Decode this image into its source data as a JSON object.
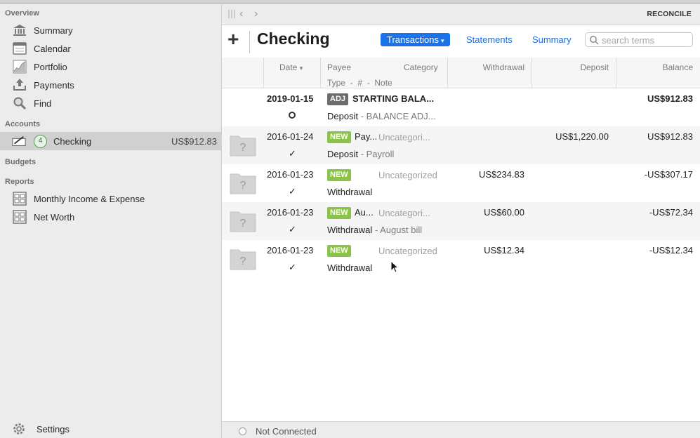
{
  "sidebar": {
    "overview_label": "Overview",
    "overview_items": [
      {
        "label": "Summary",
        "icon": "bank-icon"
      },
      {
        "label": "Calendar",
        "icon": "calendar-icon"
      },
      {
        "label": "Portfolio",
        "icon": "chart-icon"
      },
      {
        "label": "Payments",
        "icon": "upload-icon"
      },
      {
        "label": "Find",
        "icon": "magnifier-icon"
      }
    ],
    "accounts_label": "Accounts",
    "account": {
      "badge": "4",
      "label": "Checking",
      "amount": "US$912.83"
    },
    "budgets_label": "Budgets",
    "reports_label": "Reports",
    "reports_items": [
      {
        "label": "Monthly Income & Expense"
      },
      {
        "label": "Net Worth"
      }
    ],
    "settings_label": "Settings"
  },
  "navbar": {
    "reconcile_label": "RECONCILE"
  },
  "toolbar": {
    "add_label": "+",
    "title": "Checking",
    "tabs": {
      "transactions": "Transactions",
      "statements": "Statements",
      "summary": "Summary"
    },
    "search_placeholder": "search terms"
  },
  "columns": {
    "date": "Date",
    "payee": "Payee",
    "category": "Category",
    "type_line": "Type  -  #  -  Note",
    "withdrawal": "Withdrawal",
    "deposit": "Deposit",
    "balance": "Balance"
  },
  "transactions": [
    {
      "date": "2019-01-15",
      "status": "○",
      "tag": "ADJ",
      "payee": "STARTING BALA...",
      "category": "",
      "type": "Deposit",
      "note": " - BALANCE ADJ...",
      "withdrawal": "",
      "deposit": "",
      "balance": "US$912.83"
    },
    {
      "date": "2016-01-24",
      "status": "✓",
      "tag": "NEW",
      "payee": "Pay...",
      "category": "Uncategori...",
      "type": "Deposit",
      "note": " - Payroll",
      "withdrawal": "",
      "deposit": "US$1,220.00",
      "balance": "US$912.83"
    },
    {
      "date": "2016-01-23",
      "status": "✓",
      "tag": "NEW",
      "payee": "",
      "category": "Uncategorized",
      "type": "Withdrawal",
      "note": "",
      "withdrawal": "US$234.83",
      "deposit": "",
      "balance": "-US$307.17"
    },
    {
      "date": "2016-01-23",
      "status": "✓",
      "tag": "NEW",
      "payee": "Au...",
      "category": "Uncategori...",
      "type": "Withdrawal",
      "note": " - August bill",
      "withdrawal": "US$60.00",
      "deposit": "",
      "balance": "-US$72.34"
    },
    {
      "date": "2016-01-23",
      "status": "✓",
      "tag": "NEW",
      "payee": "",
      "category": "Uncategorized",
      "type": "Withdrawal",
      "note": "",
      "withdrawal": "US$12.34",
      "deposit": "",
      "balance": "-US$12.34"
    }
  ],
  "status": {
    "connection": "Not Connected"
  },
  "colors": {
    "accent": "#1a73e8",
    "new_tag": "#8bc34a",
    "adj_tag": "#6d6d6d"
  }
}
